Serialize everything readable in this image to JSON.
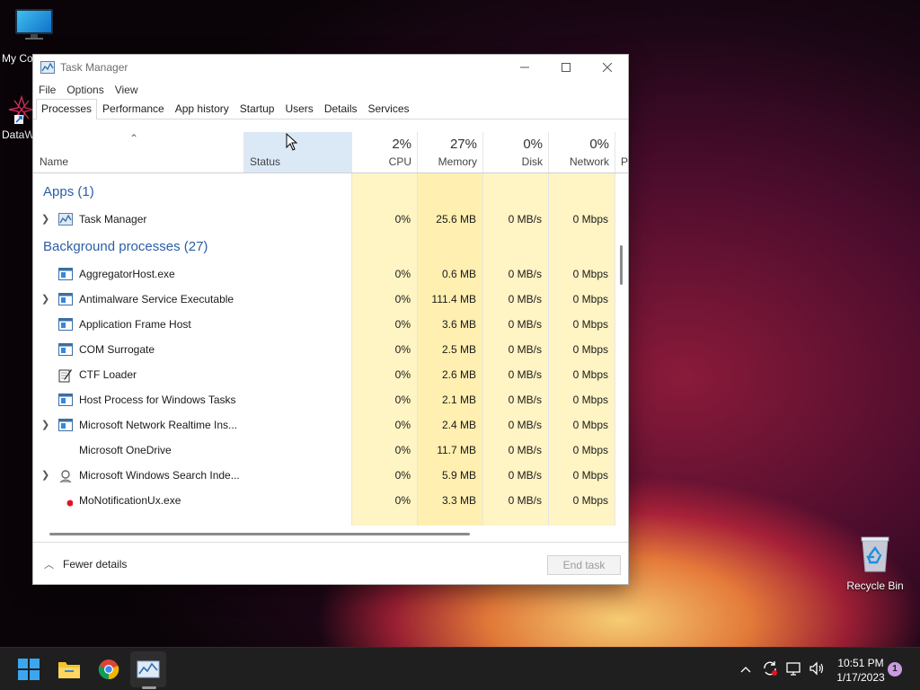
{
  "desktop": {
    "icons": [
      {
        "label": "My Co",
        "icon": "monitor-icon"
      },
      {
        "label": "DataW",
        "icon": "datawindow-icon"
      },
      {
        "label": "Recycle Bin",
        "icon": "recycle-bin-icon"
      }
    ]
  },
  "window": {
    "title": "Task Manager",
    "menu": [
      "File",
      "Options",
      "View"
    ],
    "tabs": [
      "Processes",
      "Performance",
      "App history",
      "Startup",
      "Users",
      "Details",
      "Services"
    ],
    "active_tab": "Processes",
    "columns": {
      "name": "Name",
      "status": "Status",
      "cpu": {
        "label": "CPU",
        "percent": "2%"
      },
      "memory": {
        "label": "Memory",
        "percent": "27%"
      },
      "disk": {
        "label": "Disk",
        "percent": "0%"
      },
      "network": {
        "label": "Network",
        "percent": "0%"
      },
      "power": "Po"
    },
    "groups": {
      "apps": "Apps (1)",
      "background": "Background processes (27)"
    },
    "apps": [
      {
        "name": "Task Manager",
        "cpu": "0%",
        "memory": "25.6 MB",
        "disk": "0 MB/s",
        "network": "0 Mbps",
        "expandable": true,
        "icon": "task-manager-icon"
      }
    ],
    "processes": [
      {
        "name": "AggregatorHost.exe",
        "cpu": "0%",
        "memory": "0.6 MB",
        "disk": "0 MB/s",
        "network": "0 Mbps",
        "expandable": false,
        "icon": "window-app-icon"
      },
      {
        "name": "Antimalware Service Executable",
        "cpu": "0%",
        "memory": "111.4 MB",
        "disk": "0 MB/s",
        "network": "0 Mbps",
        "expandable": true,
        "icon": "window-app-icon"
      },
      {
        "name": "Application Frame Host",
        "cpu": "0%",
        "memory": "3.6 MB",
        "disk": "0 MB/s",
        "network": "0 Mbps",
        "expandable": false,
        "icon": "window-app-icon"
      },
      {
        "name": "COM Surrogate",
        "cpu": "0%",
        "memory": "2.5 MB",
        "disk": "0 MB/s",
        "network": "0 Mbps",
        "expandable": false,
        "icon": "window-app-icon"
      },
      {
        "name": "CTF Loader",
        "cpu": "0%",
        "memory": "2.6 MB",
        "disk": "0 MB/s",
        "network": "0 Mbps",
        "expandable": false,
        "icon": "pen-notepad-icon"
      },
      {
        "name": "Host Process for Windows Tasks",
        "cpu": "0%",
        "memory": "2.1 MB",
        "disk": "0 MB/s",
        "network": "0 Mbps",
        "expandable": false,
        "icon": "window-app-icon"
      },
      {
        "name": "Microsoft Network Realtime Ins...",
        "cpu": "0%",
        "memory": "2.4 MB",
        "disk": "0 MB/s",
        "network": "0 Mbps",
        "expandable": true,
        "icon": "window-app-icon"
      },
      {
        "name": "Microsoft OneDrive",
        "cpu": "0%",
        "memory": "11.7 MB",
        "disk": "0 MB/s",
        "network": "0 Mbps",
        "expandable": false,
        "icon": "none"
      },
      {
        "name": "Microsoft Windows Search Inde...",
        "cpu": "0%",
        "memory": "5.9 MB",
        "disk": "0 MB/s",
        "network": "0 Mbps",
        "expandable": true,
        "icon": "search-indexer-icon"
      },
      {
        "name": "MoNotificationUx.exe",
        "cpu": "0%",
        "memory": "3.3 MB",
        "disk": "0 MB/s",
        "network": "0 Mbps",
        "expandable": false,
        "icon": "red-dot-icon"
      }
    ],
    "footer": {
      "fewer_details": "Fewer details",
      "end_task": "End task"
    }
  },
  "taskbar": {
    "apps": [
      "start-icon",
      "file-explorer-icon",
      "chrome-icon",
      "task-manager-icon"
    ],
    "clock": {
      "time": "10:51 PM",
      "date": "1/17/2023"
    },
    "notification_count": "1"
  },
  "colors": {
    "heat_light": "#fff4c4",
    "heat_mem": "#ffefb0",
    "group_title": "#2b5ea7",
    "taskbar": "#1f1f1f"
  }
}
